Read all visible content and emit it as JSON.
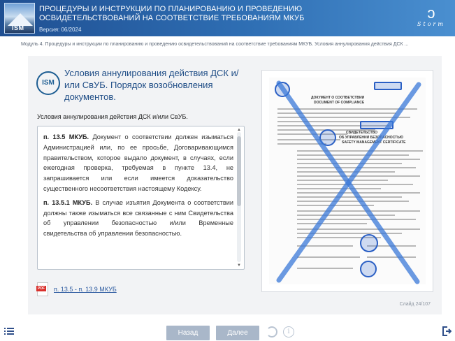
{
  "header": {
    "title": "ПРОЦЕДУРЫ И ИНСТРУКЦИИ ПО ПЛАНИРОВАНИЮ И ПРОВЕДЕНИЮ ОСВИДЕТЕЛЬСТВОВАНИЙ НА СООТВЕТСТВИЕ ТРЕБОВАНИЯМ МКУБ",
    "version": "Версия: 06/2024",
    "logo_text": "ISM",
    "brand": "Storm"
  },
  "breadcrumb": "Модуль 4. Процедуры и инструкции по планированию и проведению освидетельствований на соответствие требованиям МКУБ. Условия аннулирования действия ДСК ...",
  "main": {
    "icon_label": "ISM",
    "heading": "Условия аннулирования действия ДСК и/или СвУБ. Порядок возобновления документов.",
    "sub_heading": "Условия аннулирования действия ДСК и/или СвУБ.",
    "paragraph1_ref": "п. 13.5 МКУБ.",
    "paragraph1_text": " Документ о соответствии должен изыматься Администрацией или, по ее просьбе, Договаривающимся правительством, которое выдало документ, в случаях, если ежегодная проверка, требуемая в пункте 13.4, не запрашивается или если имеется доказательство существенного несоответствия настоящему Кодексу.",
    "paragraph2_ref": "п. 13.5.1 МКУБ.",
    "paragraph2_text": " В случае изъятия Документа о соответствии должны также изыматься все связанные с ним Свидетельства об управлении безопасностью и/или Временные свидетельства об управлении безопасностью.",
    "pdf_tag": "PDF",
    "pdf_link": "п. 13.5 - п. 13.9 МКУБ",
    "doc_titles": [
      "ДОКУМЕНТ О СООТВЕТСТВИИ",
      "DOCUMENT OF COMPLIANCE",
      "СВИДЕТЕЛЬСТВО",
      "ОБ УПРАВЛЕНИИ БЕЗОПАСНОСТЬЮ",
      "SAFETY MANAGEMENT CERTIFICATE"
    ],
    "slide_counter": "Слайд 24/107"
  },
  "footer": {
    "back_label": "Назад",
    "next_label": "Далее",
    "info_glyph": "i"
  },
  "colors": {
    "header": "#2f6fb4",
    "heading": "#1f4d86",
    "button": "#a9b7c9",
    "cross": "#3a78d8"
  }
}
